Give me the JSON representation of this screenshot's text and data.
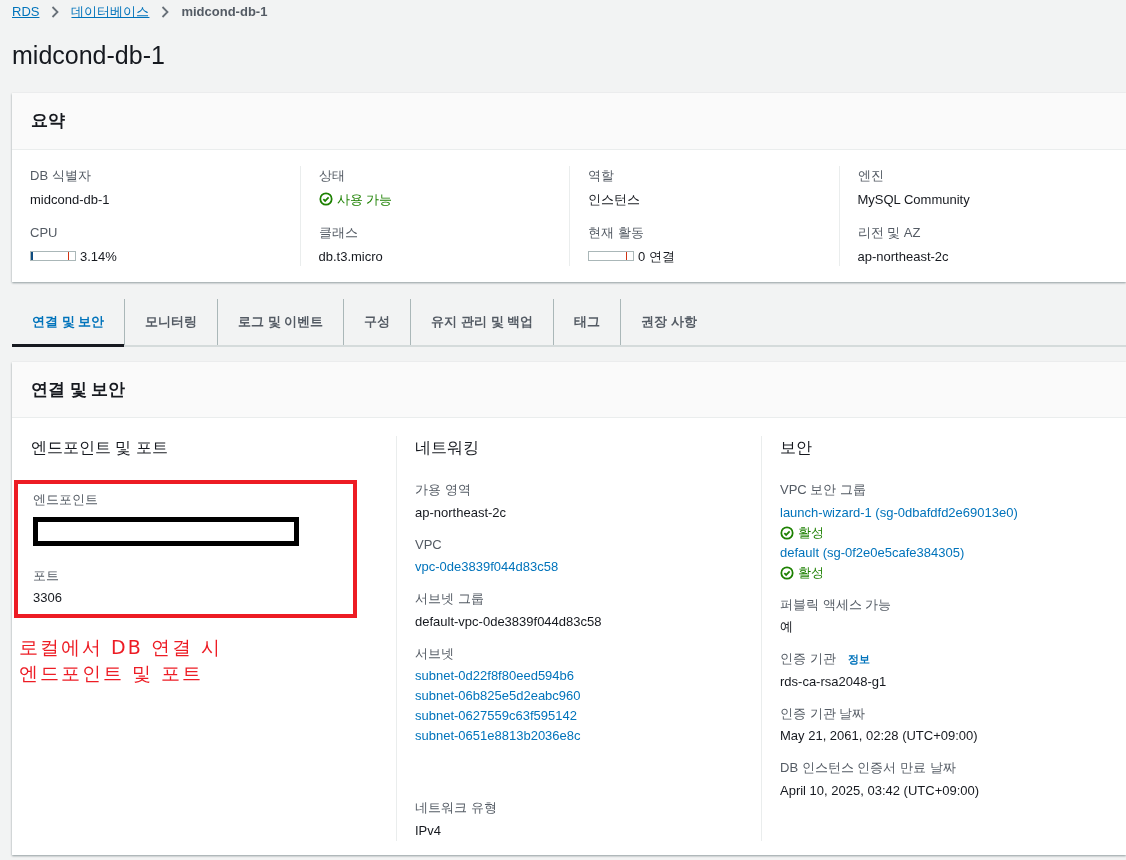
{
  "breadcrumbs": [
    {
      "label": "RDS",
      "kind": "link"
    },
    {
      "label": "데이터베이스",
      "kind": "link"
    },
    {
      "label": "midcond-db-1",
      "kind": "current"
    }
  ],
  "title": "midcond-db-1",
  "summary": {
    "title": "요약",
    "columns": [
      {
        "fields": [
          {
            "label": "DB 식별자",
            "kind": "text",
            "value": "midcond-db-1"
          },
          {
            "label": "CPU",
            "kind": "meter",
            "level": 0.03,
            "value": "3.14%"
          }
        ]
      },
      {
        "fields": [
          {
            "label": "상태",
            "kind": "status",
            "value": "사용 가능"
          },
          {
            "label": "클래스",
            "kind": "text",
            "value": "db.t3.micro"
          }
        ]
      },
      {
        "fields": [
          {
            "label": "역할",
            "kind": "text",
            "value": "인스턴스"
          },
          {
            "label": "현재 활동",
            "kind": "meter",
            "level": 0,
            "value": "0 연결"
          }
        ]
      },
      {
        "fields": [
          {
            "label": "엔진",
            "kind": "text",
            "value": "MySQL Community"
          },
          {
            "label": "리전 및 AZ",
            "kind": "text",
            "value": "ap-northeast-2c"
          }
        ]
      }
    ]
  },
  "tabs": [
    {
      "label": "연결 및 보안",
      "selected": true
    },
    {
      "label": "모니터링",
      "selected": false
    },
    {
      "label": "로그 및 이벤트",
      "selected": false
    },
    {
      "label": "구성",
      "selected": false
    },
    {
      "label": "유지 관리 및 백업",
      "selected": false
    },
    {
      "label": "태그",
      "selected": false
    },
    {
      "label": "권장 사항",
      "selected": false
    }
  ],
  "section": {
    "title": "연결 및 보안",
    "columns": [
      {
        "heading": "엔드포인트 및 포트",
        "fields": [
          {
            "label": "엔드포인트",
            "values": [
              {
                "kind": "redacted"
              }
            ]
          },
          {
            "label": "포트",
            "values": [
              {
                "kind": "text",
                "text": "3306"
              }
            ]
          }
        ],
        "annotation": [
          "로컬에서 DB 연결 시",
          "엔드포인트 및 포트"
        ]
      },
      {
        "heading": "네트워킹",
        "fields": [
          {
            "label": "가용 영역",
            "values": [
              {
                "kind": "text",
                "text": "ap-northeast-2c"
              }
            ]
          },
          {
            "label": "VPC",
            "values": [
              {
                "kind": "link",
                "text": "vpc-0de3839f044d83c58"
              }
            ]
          },
          {
            "label": "서브넷 그룹",
            "values": [
              {
                "kind": "text",
                "text": "default-vpc-0de3839f044d83c58"
              }
            ]
          },
          {
            "label": "서브넷",
            "values": [
              {
                "kind": "link",
                "text": "subnet-0d22f8f80eed594b6"
              },
              {
                "kind": "link",
                "text": "subnet-06b825e5d2eabc960"
              },
              {
                "kind": "link",
                "text": "subnet-0627559c63f595142"
              },
              {
                "kind": "link",
                "text": "subnet-0651e8813b2036e8c"
              }
            ]
          },
          {
            "label": "네트워크 유형",
            "values": [
              {
                "kind": "text",
                "text": "IPv4"
              }
            ]
          }
        ]
      },
      {
        "heading": "보안",
        "fields": [
          {
            "label": "VPC 보안 그룹",
            "values": [
              {
                "kind": "link",
                "text": "launch-wizard-1 (sg-0dbafdfd2e69013e0)"
              },
              {
                "kind": "status",
                "text": "활성"
              },
              {
                "kind": "link",
                "text": "default (sg-0f2e0e5cafe384305)"
              },
              {
                "kind": "status",
                "text": "활성"
              }
            ]
          },
          {
            "label": "퍼블릭 액세스 가능",
            "values": [
              {
                "kind": "text",
                "text": "예"
              }
            ]
          },
          {
            "label": "인증 기관",
            "info": "정보",
            "values": [
              {
                "kind": "text",
                "text": "rds-ca-rsa2048-g1"
              }
            ]
          },
          {
            "label": "인증 기관 날짜",
            "values": [
              {
                "kind": "text",
                "text": "May 21, 2061, 02:28 (UTC+09:00)"
              }
            ]
          },
          {
            "label": "DB 인스턴스 인증서 만료 날짜",
            "values": [
              {
                "kind": "text",
                "text": "April 10, 2025, 03:42 (UTC+09:00)"
              }
            ]
          }
        ]
      }
    ]
  }
}
